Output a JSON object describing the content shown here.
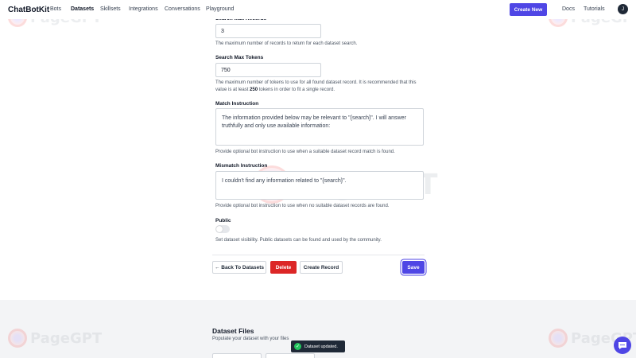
{
  "nav": {
    "brand": "ChatBotKit",
    "links": [
      "Bots",
      "Datasets",
      "Skillsets",
      "Integrations",
      "Conversations",
      "Playground"
    ],
    "create_new": "Create New",
    "docs": "Docs",
    "tutorials": "Tutorials",
    "avatar_initial": "J"
  },
  "form": {
    "search_max_records": {
      "label": "Search Max Records",
      "value": "3",
      "help": "The maximum number of records to return for each dataset search."
    },
    "search_max_tokens": {
      "label": "Search Max Tokens",
      "value": "750",
      "help_line1": "The maximum number of tokens to use for all found dataset record. It is recommended that this",
      "help_line2_prefix": "value is at least ",
      "help_line2_bold": "250",
      "help_line2_suffix": " tokens in order to fit a single record."
    },
    "match_instruction": {
      "label": "Match Instruction",
      "value": "The information provided below may be relevant to \"{search}\". I will answer truthfully and only use available information:",
      "help": "Provide optional bot instruction to use when a suitable dataset record match is found."
    },
    "mismatch_instruction": {
      "label": "Mismatch Instruction",
      "value": "I couldn't find any information related to \"{search}\".",
      "help": "Provide optional bot instruction to use when no suitable dataset records are found."
    },
    "public": {
      "label": "Public",
      "enabled": false,
      "help": "Set dataset visibility. Public datasets can be found and used by the community."
    }
  },
  "actions": {
    "back": "← Back To Datasets",
    "delete": "Delete",
    "create_record": "Create Record",
    "save": "Save"
  },
  "files": {
    "title": "Dataset Files",
    "subtitle": "Populate your dataset with your files"
  },
  "toast": {
    "message": "Dataset updated."
  },
  "watermark": "PageGPT",
  "colors": {
    "primary": "#4f46e5",
    "danger": "#dc2626",
    "success": "#22c55e"
  }
}
